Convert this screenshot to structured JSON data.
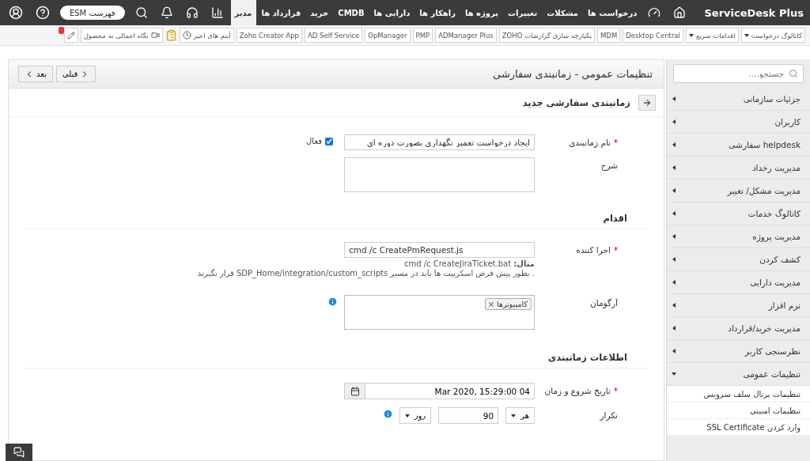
{
  "topbar": {
    "logo": "ServiceDesk Plus",
    "nav": [
      {
        "label": "درخواست ها",
        "selected": false
      },
      {
        "label": "مشکلات",
        "selected": false
      },
      {
        "label": "تغییرات",
        "selected": false
      },
      {
        "label": "پروژه ها",
        "selected": false
      },
      {
        "label": "راهکار ها",
        "selected": false
      },
      {
        "label": "دارایی ها",
        "selected": false
      },
      {
        "label": "CMDB",
        "selected": false
      },
      {
        "label": "خرید",
        "selected": false
      },
      {
        "label": "قرارداد ها",
        "selected": false
      },
      {
        "label": "مدیر",
        "selected": true
      }
    ],
    "esm_button": "فهرست ESM"
  },
  "toolbar": {
    "items": [
      {
        "kind": "dropdown",
        "label": "کاتالوگ درخواست"
      },
      {
        "kind": "dropdown",
        "label": "اقدامات سریع"
      },
      {
        "kind": "link",
        "label": "Desktop Central"
      },
      {
        "kind": "link",
        "label": "MDM"
      },
      {
        "kind": "link",
        "label": "یکپارچه سازی گزارشات ZOHO"
      },
      {
        "kind": "link",
        "label": "ADManager Plus"
      },
      {
        "kind": "link",
        "label": "PMP"
      },
      {
        "kind": "link",
        "label": "OpManager"
      },
      {
        "kind": "link",
        "label": "AD Self Service"
      },
      {
        "kind": "link",
        "label": "Zoho Creator App"
      },
      {
        "kind": "recent",
        "label": "آیتم های اخیر"
      }
    ],
    "tour_button": "نگاه اجمالی به محصول"
  },
  "sidebar": {
    "search": {
      "placeholder": "جستجو...."
    },
    "items": [
      {
        "label": "جزئیات سازمانی",
        "expanded": false
      },
      {
        "label": "کاربران",
        "expanded": false
      },
      {
        "label": "helpdesk سفارشی",
        "expanded": false
      },
      {
        "label": "مدیریت رخداد",
        "expanded": false
      },
      {
        "label": "مدیریت مشکل/ تغییر",
        "expanded": false
      },
      {
        "label": "کاتالوگ خدمات",
        "expanded": false
      },
      {
        "label": "مدیریت پروژه",
        "expanded": false
      },
      {
        "label": "کشف کردن",
        "expanded": false
      },
      {
        "label": "مدیریت دارایی",
        "expanded": false
      },
      {
        "label": "نرم افزار",
        "expanded": false
      },
      {
        "label": "مدیریت خرید/قرارداد",
        "expanded": false
      },
      {
        "label": "نظرسنجی کاربر",
        "expanded": false
      },
      {
        "label": "تنظیمات عمومی",
        "expanded": true,
        "children": [
          {
            "label": "تنظیمات پرتال سلف سرویس"
          },
          {
            "label": "تنظیمات امنیتی"
          },
          {
            "label": "وارد کردن SSL Certificate"
          }
        ]
      }
    ]
  },
  "header": {
    "title": "تنظیمات عمومی - زمانبندی سفارشی",
    "prev_button": "قبلی",
    "next_button": "بعد"
  },
  "form": {
    "title": "زمانبندی سفارشی جدید",
    "name": {
      "label": "نام زمانبندی",
      "required": true,
      "value": "ایجاد درخواست تعمیر نگهداری بصورت دوره ای",
      "active_label": "فعال",
      "active_checked": true
    },
    "description": {
      "label": "شرح",
      "required": false
    },
    "action_section": "اقدام",
    "executor": {
      "label": "اجرا کننده",
      "required": true,
      "value": "cmd /c CreatePmRequest.js",
      "example": "**مثال:** cmd /c CreateJiraTicket.bat",
      "note": ". بطور پیش فرض اسکریپت ها باید در مسیر SDP_Home/integration/custom_scripts قرار بگیرند"
    },
    "argument": {
      "label": "آرگومان",
      "required": false,
      "chips": [
        "کامپیوترها"
      ]
    },
    "schedule_section": "اطلاعات زمانبندی",
    "start": {
      "label": "تاریخ شروع و زمان",
      "required": true,
      "value": "04 Mar 2020, 15:29:00"
    },
    "repeat": {
      "label": "تکرار",
      "required": false,
      "every": "هر",
      "count": "90",
      "unit": "روز"
    }
  }
}
